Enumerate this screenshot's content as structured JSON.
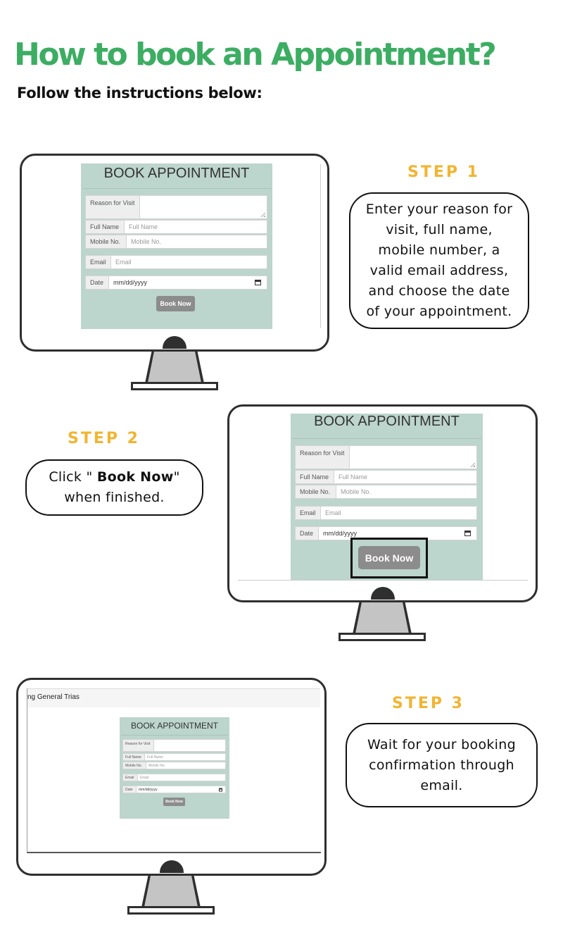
{
  "header": {
    "title": "How to book an Appointment?",
    "subtitle": "Follow the instructions below:"
  },
  "steps": [
    {
      "label": "STEP 1",
      "text": "Enter your reason for visit, full name, mobile number, a valid email address, and choose the date of your appointment."
    },
    {
      "label": "STEP 2",
      "text_prefix": "Click \" ",
      "text_bold": "Book Now",
      "text_suffix": "\" when finished."
    },
    {
      "label": "STEP 3",
      "text": "Wait for your booking confirmation through email."
    }
  ],
  "form": {
    "title": "BOOK APPOINTMENT",
    "reason_label": "Reason for Visit",
    "fullname_label": "Full Name",
    "fullname_placeholder": "Full Name",
    "mobile_label": "Mobile No.",
    "mobile_placeholder": "Mobile No.",
    "email_label": "Email",
    "email_placeholder": "Email",
    "date_label": "Date",
    "date_placeholder": "mm/dd/yyyy",
    "book_button": "Book Now"
  },
  "browser_header_text": "ng General Trias",
  "icons": {
    "date": "calendar-icon",
    "camera": "camera-notch-icon"
  },
  "colors": {
    "title": "#3cad62",
    "step": "#f2b431",
    "form_bg": "#bcd5cd",
    "button": "#8c8c8c"
  }
}
